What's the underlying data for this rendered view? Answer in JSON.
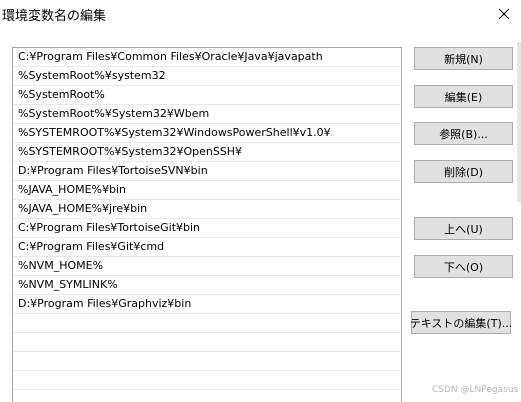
{
  "window": {
    "title": "環境変数名の編集"
  },
  "list": {
    "items": [
      "C:¥Program Files¥Common Files¥Oracle¥Java¥javapath",
      "%SystemRoot%¥system32",
      "%SystemRoot%",
      "%SystemRoot%¥System32¥Wbem",
      "%SYSTEMROOT%¥System32¥WindowsPowerShell¥v1.0¥",
      "%SYSTEMROOT%¥System32¥OpenSSH¥",
      "D:¥Program Files¥TortoiseSVN¥bin",
      "%JAVA_HOME%¥bin",
      "%JAVA_HOME%¥jre¥bin",
      "C:¥Program Files¥TortoiseGit¥bin",
      "C:¥Program Files¥Git¥cmd",
      "%NVM_HOME%",
      "%NVM_SYMLINK%",
      "D:¥Program Files¥Graphviz¥bin",
      "",
      "",
      "",
      "",
      ""
    ]
  },
  "buttons": {
    "new": "新規(N)",
    "edit": "編集(E)",
    "browse": "参照(B)...",
    "delete": "削除(D)",
    "up": "上へ(U)",
    "down": "下へ(O)",
    "edit_text": "テキストの編集(T)..."
  },
  "watermark": "CSDN @LNPegasus",
  "icons": {
    "close": "close-icon"
  }
}
